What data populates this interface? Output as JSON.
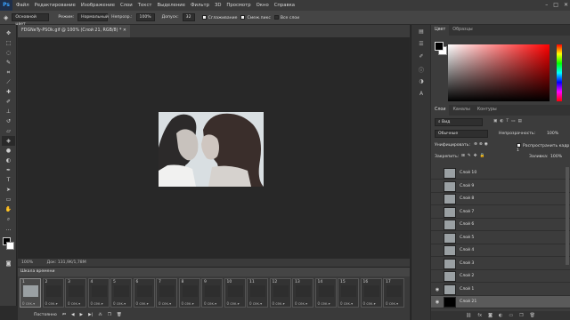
{
  "app": {
    "logo": "Ps"
  },
  "menu": [
    "Файл",
    "Редактирование",
    "Изображение",
    "Слои",
    "Текст",
    "Выделение",
    "Фильтр",
    "3D",
    "Просмотр",
    "Окно",
    "Справка"
  ],
  "window_controls": [
    "–",
    "□",
    "✕"
  ],
  "options": {
    "tool_preset": "Основной цвет",
    "mode_label": "Режим:",
    "mode_value": "Нормальный",
    "opacity_label": "Непрозр.:",
    "opacity_value": "100%",
    "tolerance_label": "Допуск:",
    "tolerance_value": "32",
    "antialias_label": "Сглаживание",
    "contiguous_label": "Смеж.пикс",
    "all_layers_label": "Все слои"
  },
  "document": {
    "tab_title": "FDGNeTy-PSOk.gif @ 100% (Слой 21, RGB/8) *",
    "zoom": "100%",
    "doc_size": "Док: 131,9K/1,78M"
  },
  "timeline": {
    "title": "Шкала времени",
    "frames": [
      {
        "num": "1",
        "sec": "0 сек.▾"
      },
      {
        "num": "2",
        "sec": "0 сек.▾"
      },
      {
        "num": "3",
        "sec": "0 сек.▾"
      },
      {
        "num": "4",
        "sec": "0 сек.▾"
      },
      {
        "num": "5",
        "sec": "0 сек.▾"
      },
      {
        "num": "6",
        "sec": "0 сек.▾"
      },
      {
        "num": "7",
        "sec": "0 сек.▾"
      },
      {
        "num": "8",
        "sec": "0 сек.▾"
      },
      {
        "num": "9",
        "sec": "0 сек.▾"
      },
      {
        "num": "10",
        "sec": "0 сек.▾"
      },
      {
        "num": "11",
        "sec": "0 сек.▾"
      },
      {
        "num": "12",
        "sec": "0 сек.▾"
      },
      {
        "num": "13",
        "sec": "0 сек.▾"
      },
      {
        "num": "14",
        "sec": "0 сек.▾"
      },
      {
        "num": "15",
        "sec": "0 сек.▾"
      },
      {
        "num": "16",
        "sec": "0 сек.▾"
      },
      {
        "num": "17",
        "sec": "0 сек.▾"
      }
    ],
    "loop_label": "Постоянно"
  },
  "color_panel": {
    "tab_color": "Цвет",
    "tab_swatches": "Образцы",
    "fg": "#000000",
    "bg": "#ffffff"
  },
  "layers_panel": {
    "tab_layers": "Слои",
    "tab_channels": "Каналы",
    "tab_paths": "Контуры",
    "kind_label": "Вид",
    "blend_mode": "Обычные",
    "opacity_label": "Непрозрачность:",
    "opacity_value": "100%",
    "unify_label": "Унифицировать:",
    "propagate_label": "Распространить кадр 1",
    "lock_label": "Закрепить:",
    "fill_label": "Заливка:",
    "fill_value": "100%",
    "layers": [
      {
        "name": "Слой 10"
      },
      {
        "name": "Слой 9"
      },
      {
        "name": "Слой 8"
      },
      {
        "name": "Слой 7"
      },
      {
        "name": "Слой 6"
      },
      {
        "name": "Слой 5"
      },
      {
        "name": "Слой 4"
      },
      {
        "name": "Слой 3"
      },
      {
        "name": "Слой 2"
      },
      {
        "name": "Слой 1"
      },
      {
        "name": "Слой 21"
      }
    ]
  }
}
